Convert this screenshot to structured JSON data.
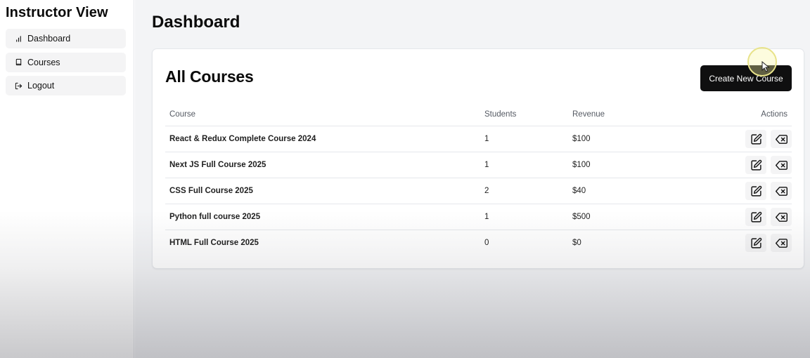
{
  "sidebar": {
    "title": "Instructor View",
    "items": [
      {
        "label": "Dashboard",
        "icon": "bar-chart-icon"
      },
      {
        "label": "Courses",
        "icon": "book-icon"
      },
      {
        "label": "Logout",
        "icon": "logout-icon"
      }
    ]
  },
  "main": {
    "title": "Dashboard",
    "card": {
      "title": "All Courses",
      "create_button_label": "Create New Course",
      "columns": [
        "Course",
        "Students",
        "Revenue",
        "Actions"
      ],
      "rows": [
        {
          "course": "React & Redux Complete Course 2024",
          "students": "1",
          "revenue": "$100"
        },
        {
          "course": "Next JS Full Course 2025",
          "students": "1",
          "revenue": "$100"
        },
        {
          "course": "CSS Full Course 2025",
          "students": "2",
          "revenue": "$40"
        },
        {
          "course": "Python full course 2025",
          "students": "1",
          "revenue": "$500"
        },
        {
          "course": "HTML Full Course 2025",
          "students": "0",
          "revenue": "$0"
        }
      ],
      "row_actions": [
        {
          "icon": "edit-icon"
        },
        {
          "icon": "delete-icon"
        }
      ]
    }
  },
  "colors": {
    "button_background": "#0f0f10",
    "main_background": "#f3f4f6",
    "nav_item_background": "#f4f4f5",
    "cursor_highlight": "#e8e38a"
  }
}
